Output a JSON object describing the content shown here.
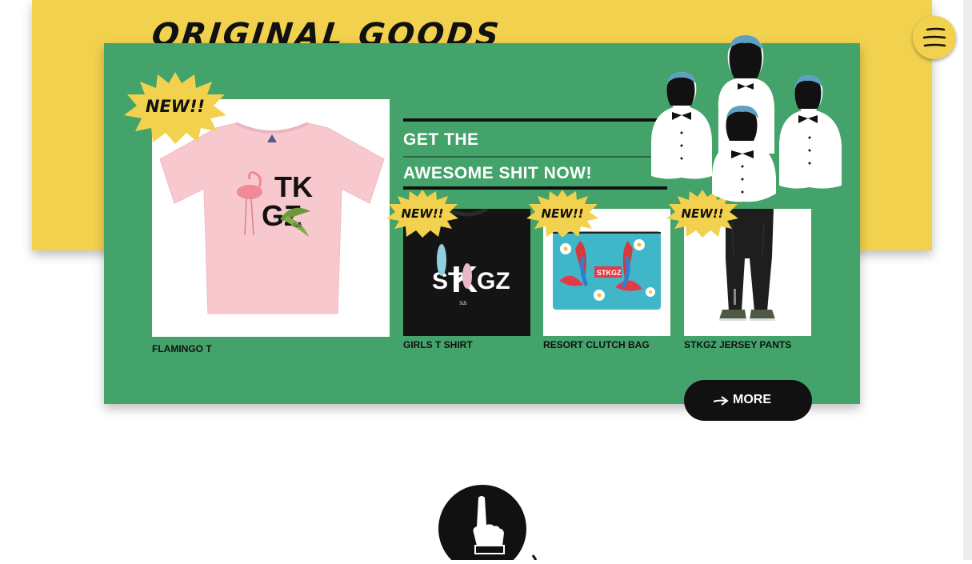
{
  "section": {
    "title": "ORIGINAL GOODS"
  },
  "badge": {
    "label": "NEW!!"
  },
  "tagline": {
    "line1": "GET THE",
    "line2": "AWESOME SHIT NOW!"
  },
  "products": [
    {
      "name": "FLAMINGO T",
      "is_new": true
    },
    {
      "name": "GIRLS T SHIRT",
      "is_new": true
    },
    {
      "name": "RESORT CLUTCH BAG",
      "is_new": true
    },
    {
      "name": "STKGZ JERSEY PANTS",
      "is_new": true
    }
  ],
  "more_button": {
    "label": "MORE"
  },
  "colors": {
    "yellow": "#f2d14e",
    "green": "#44a36a",
    "black": "#111111",
    "pink": "#f7c9cf",
    "turquoise": "#3fb7c9",
    "hair_blue": "#5f9fc2"
  },
  "icons": {
    "menu": "hamburger-icon",
    "more": "arrow-right-icon",
    "bottom": "pointing-hand-icon"
  }
}
